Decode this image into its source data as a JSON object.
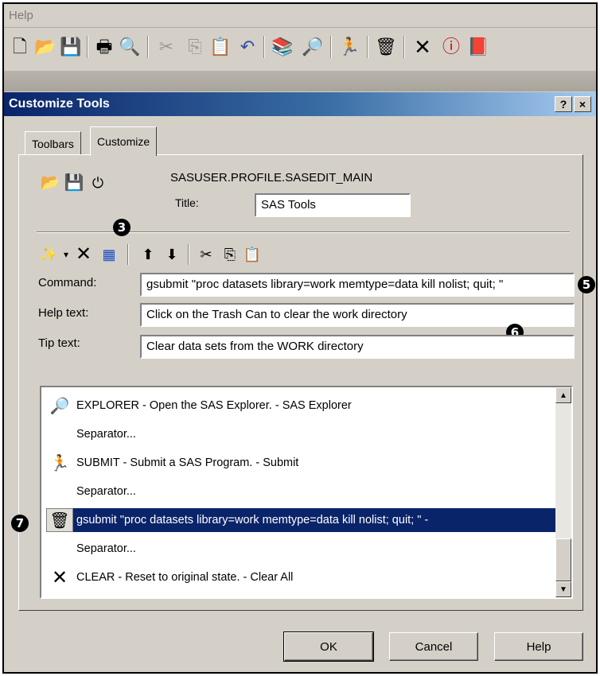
{
  "menubar": {
    "help_label": "Help"
  },
  "toolbar": {
    "icons": [
      "new-icon",
      "open-icon",
      "save-icon",
      "print-icon",
      "print-preview-icon",
      "cut-icon",
      "copy-icon",
      "paste-icon",
      "undo-icon",
      "libraries-icon",
      "explorer-icon",
      "submit-icon",
      "trash-icon",
      "clear-icon",
      "break-icon",
      "help-book-icon"
    ]
  },
  "dialog": {
    "title": "Customize Tools",
    "help_button": "?",
    "close_button": "×",
    "tabs": [
      {
        "label": "Toolbars"
      },
      {
        "label": "Customize"
      }
    ],
    "profile_name": "SASUSER.PROFILE.SASEDIT_MAIN",
    "title_label": "Title:",
    "title_value": "SAS Tools",
    "command_label": "Command:",
    "command_value": "gsubmit \"proc datasets library=work memtype=data kill nolist; quit; \"",
    "help_text_label": "Help text:",
    "help_text_value": "Click on the Trash Can to clear the work directory",
    "tip_text_label": "Tip text:",
    "tip_text_value": "Clear data sets from the WORK directory",
    "list_items": [
      {
        "icon": "explorer-icon",
        "text": "EXPLORER - Open the SAS Explorer. - SAS Explorer"
      },
      {
        "icon": "",
        "text": "Separator..."
      },
      {
        "icon": "submit-icon",
        "text": "SUBMIT - Submit a SAS Program. - Submit"
      },
      {
        "icon": "",
        "text": "Separator..."
      },
      {
        "icon": "trash-icon",
        "text": "gsubmit \"proc datasets library=work memtype=data kill nolist; quit; \" -",
        "selected": true
      },
      {
        "icon": "",
        "text": "Separator..."
      },
      {
        "icon": "clear-icon",
        "text": "CLEAR - Reset to original state. - Clear All"
      }
    ],
    "buttons": {
      "ok": "OK",
      "cancel": "Cancel",
      "help": "Help"
    }
  },
  "callouts": {
    "c3": "3",
    "c5": "5",
    "c6": "6",
    "c7": "7"
  }
}
